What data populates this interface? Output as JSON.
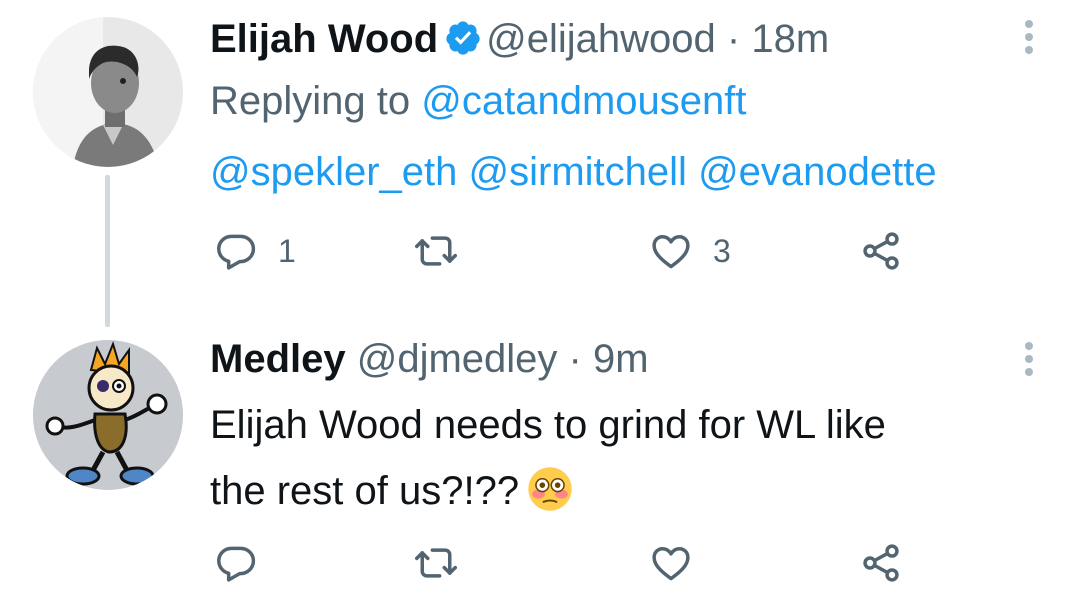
{
  "tweets": [
    {
      "name": "Elijah Wood",
      "handle": "@elijahwood",
      "separator": "·",
      "time": "18m",
      "verified": true,
      "replying_prefix": "Replying to",
      "replying_to": [
        "@catandmousenft",
        "@spekler_eth",
        "@sirmitchell",
        "@evanodette"
      ],
      "reply_count": "1",
      "retweet_count": "",
      "like_count": "3"
    },
    {
      "name": "Medley",
      "handle": "@djmedley",
      "separator": "·",
      "time": "9m",
      "verified": false,
      "text_line1": "Elijah Wood needs to grind for WL like",
      "text_line2": "the rest of us?!??",
      "emoji": "flushed-face",
      "reply_count": "",
      "retweet_count": "",
      "like_count": ""
    }
  ],
  "colors": {
    "text": "#0f1419",
    "secondary": "#536471",
    "link": "#1d9bf0",
    "thread_line": "#cfd9de",
    "verified": "#1d9bf0"
  }
}
